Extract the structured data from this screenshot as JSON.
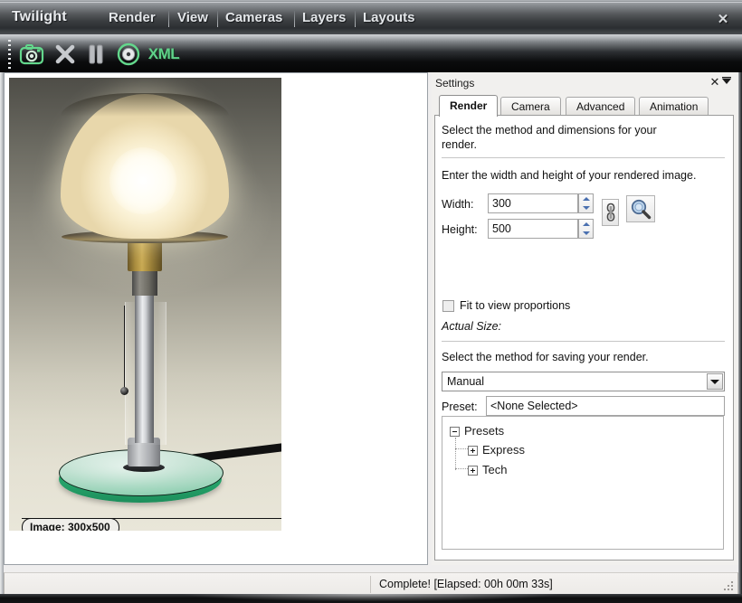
{
  "window": {
    "app_title": "Twilight",
    "close_label": "✕",
    "menu": [
      {
        "label": "Render"
      },
      {
        "label": "View"
      },
      {
        "label": "Cameras"
      },
      {
        "label": "Layers"
      },
      {
        "label": "Layouts"
      }
    ]
  },
  "toolbar": {
    "buttons": [
      {
        "name": "render-camera-button",
        "icon": "camera-icon",
        "label": ""
      },
      {
        "name": "stop-render-button",
        "icon": "x-close-icon",
        "label": ""
      },
      {
        "name": "pause-render-button",
        "icon": "pause-icon",
        "label": ""
      },
      {
        "name": "save-render-button",
        "icon": "disc-icon",
        "label": ""
      },
      {
        "name": "export-xml-button",
        "icon": "xml-icon",
        "label": "XML"
      }
    ]
  },
  "preview": {
    "caption": "Image: 300x500"
  },
  "settings": {
    "title": "Settings",
    "close_label": "✕",
    "tabs": [
      {
        "label": "Render",
        "active": true
      },
      {
        "label": "Camera",
        "active": false
      },
      {
        "label": "Advanced",
        "active": false
      },
      {
        "label": "Animation",
        "active": false
      }
    ],
    "overflow_label": "▾",
    "intro_line1": "Select the method and dimensions for your",
    "intro_line2": "render.",
    "dimensions_prompt": "Enter the width and height of your rendered image.",
    "width_label": "Width:",
    "width_value": "300",
    "height_label": "Height:",
    "height_value": "500",
    "link_button_name": "link-aspect-icon",
    "zoom_button_name": "magnifier-icon",
    "fit_checkbox_label": "Fit to view proportions",
    "fit_checkbox_checked": false,
    "actual_size_label": "Actual Size:",
    "actual_size_value": "",
    "saving_prompt": "Select the method for saving your render.",
    "method_value": "Manual",
    "method_options": [
      "Manual"
    ],
    "preset_label": "Preset:",
    "preset_value": "<None Selected>",
    "tree": {
      "root": {
        "label": "Presets",
        "expanded": true
      },
      "children": [
        {
          "label": "Express",
          "expanded": false
        },
        {
          "label": "Tech",
          "expanded": false
        }
      ]
    }
  },
  "statusbar": {
    "message": "Complete!  [Elapsed: 00h 00m 33s]"
  },
  "colors": {
    "accent_green": "#2ea86f",
    "titlebar_text": "#e9ebee",
    "spinner_blue": "#4a70b0"
  }
}
